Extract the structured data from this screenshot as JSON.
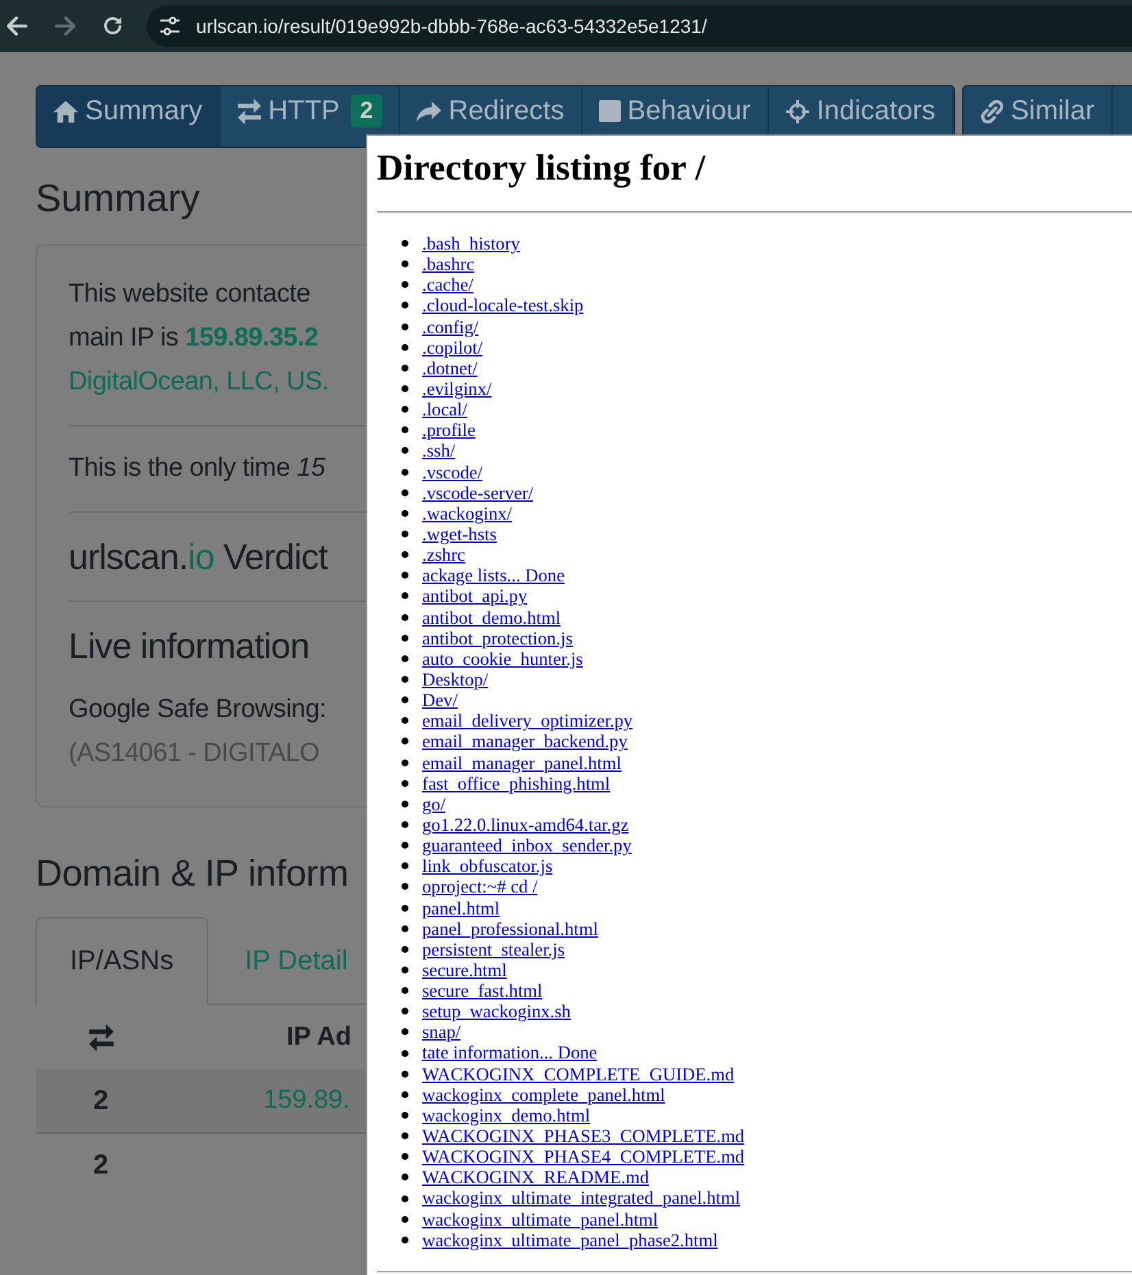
{
  "browser": {
    "url": "urlscan.io/result/019e992b-dbbb-768e-ac63-54332e5e1231/",
    "forward_disabled": true
  },
  "nav_tab_groups": [
    {
      "tabs": [
        {
          "label": "Summary",
          "selected": true
        },
        {
          "label": "HTTP",
          "badge": "2",
          "selected": false
        },
        {
          "label": "Redirects",
          "selected": false
        },
        {
          "label": "Behaviour",
          "selected": false
        },
        {
          "label": "Indicators",
          "selected": false
        }
      ]
    },
    {
      "tabs": [
        {
          "label": "Similar",
          "selected": false
        }
      ]
    }
  ],
  "summary": {
    "heading": "Summary",
    "sections": [
      {
        "lines": [
          {
            "kind": "text",
            "text": "This website contacte"
          },
          {
            "kind": "text",
            "text": "main IP is **159.89.35.2**"
          },
          {
            "kind": "link",
            "text": "DigitalOcean, LLC, US."
          }
        ]
      },
      {
        "lines": [
          {
            "kind": "text",
            "text": "This is the only time *15*"
          }
        ]
      },
      {
        "heading": "urlscan.**io** Verdict"
      },
      {
        "heading": "Live information",
        "lines": [
          {
            "kind": "text",
            "text": "Google Safe Browsing:"
          },
          {
            "kind": "muted",
            "text": "(AS14061 - DIGITALO"
          }
        ]
      }
    ]
  },
  "domain_ip": {
    "heading": "Domain & IP inform",
    "tabs": [
      {
        "label": "IP/ASNs",
        "selected": true
      },
      {
        "label": "IP Detail",
        "selected": false
      }
    ],
    "table": {
      "header": {
        "column_2": "IP Ad"
      },
      "rows": [
        {
          "column_1": "2",
          "column_2": "159.89."
        },
        {
          "column_1": "2"
        }
      ]
    }
  },
  "directory_listing": {
    "title": "Directory listing for /",
    "entries": [
      ".bash_history",
      ".bashrc",
      ".cache/",
      ".cloud-locale-test.skip",
      ".config/",
      ".copilot/",
      ".dotnet/",
      ".evilginx/",
      ".local/",
      ".profile",
      ".ssh/",
      ".vscode/",
      ".vscode-server/",
      ".wackoginx/",
      ".wget-hsts",
      ".zshrc",
      "ackage lists... Done",
      "antibot_api.py",
      "antibot_demo.html",
      "antibot_protection.js",
      "auto_cookie_hunter.js",
      "Desktop/",
      "Dev/",
      "email_delivery_optimizer.py",
      "email_manager_backend.py",
      "email_manager_panel.html",
      "fast_office_phishing.html",
      "go/",
      "go1.22.0.linux-amd64.tar.gz",
      "guaranteed_inbox_sender.py",
      "link_obfuscator.js",
      "oproject:~# cd /",
      "panel.html",
      "panel_professional.html",
      "persistent_stealer.js",
      "secure.html",
      "secure_fast.html",
      "setup_wackoginx.sh",
      "snap/",
      "tate information... Done",
      "WACKOGINX_COMPLETE_GUIDE.md",
      "wackoginx_complete_panel.html",
      "wackoginx_demo.html",
      "WACKOGINX_PHASE3_COMPLETE.md",
      "WACKOGINX_PHASE4_COMPLETE.md",
      "WACKOGINX_README.md",
      "wackoginx_ultimate_integrated_panel.html",
      "wackoginx_ultimate_panel.html",
      "wackoginx_ultimate_panel_phase2.html"
    ]
  }
}
